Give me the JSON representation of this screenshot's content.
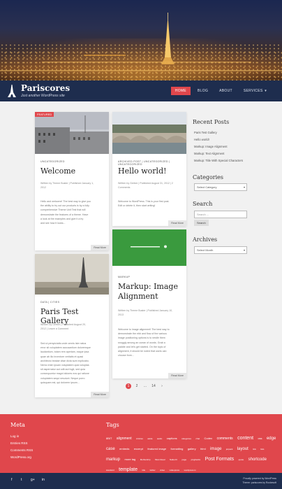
{
  "site": {
    "title": "Pariscores",
    "tagline": "Just another WordPress site"
  },
  "nav": {
    "items": [
      {
        "label": "HOME",
        "active": true
      },
      {
        "label": "BLOG",
        "active": false
      },
      {
        "label": "ABOUT",
        "active": false
      },
      {
        "label": "SERVICES",
        "active": false,
        "has_dropdown": true
      }
    ]
  },
  "posts": [
    {
      "badge": "FEATURED",
      "category": "UNCATEGORIZED",
      "title": "Welcome",
      "meta_line1": "Written by Theme Buster | Published January 1,",
      "meta_line2": "2012",
      "excerpt": [
        "Hello and welcome! The best way to give you",
        "the ability to try out our products is by a fully",
        "comprehensive Theme Unit Test that will",
        "demonstrate the features of a theme. Have",
        "a look at the examples and give it a try",
        "and see how it looks..."
      ],
      "read_more": "Read More"
    },
    {
      "category": "ARCHIVED POST | UNCATEGORIZED | UNCATEGORIZED",
      "title": "Hello world!",
      "meta_line1": "Written by Gerber | Published August 31, 2012 | 2",
      "meta_line2": "Comments",
      "excerpt": [
        "Welcome to WordPress. This is your first post.",
        "Edit or delete it, then start writing!"
      ],
      "read_more": "Read More"
    },
    {
      "category": "DATA | CITIES",
      "title": "Paris Test Gallery",
      "meta_line1": "Written by Gerber | Published August 20,",
      "meta_line2": "2012 | Leave a Comment",
      "excerpt": [
        "Sed ut perspiciatis unde omnis iste natus",
        "error sit voluptatem accusantium doloremque",
        "laudantium, totam rem aperiam, eaque ipsa",
        "quae ab illo inventore veritatis et quasi",
        "architecto beatae vitae dicta sunt explicabo.",
        "Nemo enim ipsam voluptatem quia voluptas",
        "sit aspernatur aut odit aut fugit, sed quia",
        "consequuntur magni dolores eos qui ratione",
        "voluptatem sequi nesciunt. Neque porro",
        "quisquam est, qui dolorem ipsum..."
      ],
      "read_more": "Read More"
    },
    {
      "category": "MARKUP",
      "title_line1": "Markup: Image",
      "title_line2": "Alignment",
      "meta_line1": "Written by Theme Buster | Published January 10,",
      "meta_line2": "2013",
      "excerpt": [
        "Welcome to image alignment! The best way to",
        "demonstrate the ebb and flow of the various",
        "image positioning options is to nestle them",
        "snuggly among an ocean of words. Grab a",
        "paddle and let's get started. On the topic of",
        "alignment, it should be noted that users can",
        "choose from..."
      ],
      "read_more": "Read More"
    }
  ],
  "pagination": {
    "pages": [
      "1",
      "2",
      "...",
      "14"
    ],
    "next": "›"
  },
  "sidebar": {
    "recent_title": "Recent Posts",
    "recent": [
      "Paris Test Gallery",
      "Hello world!",
      "Markup: Image Alignment",
      "Markup: Text Alignment",
      "Markup: Title With Special Characters"
    ],
    "categories_title": "Categories",
    "categories_select": "Select Category",
    "search_title": "Search",
    "search_placeholder": "Search ...",
    "search_button": "Search",
    "archives_title": "Archives",
    "archives_select": "Select Month"
  },
  "footer": {
    "meta_title": "Meta",
    "meta_links": [
      "Log in",
      "Entries RSS",
      "Comments RSS",
      "WordPress.org"
    ],
    "tags_title": "Tags",
    "tags": [
      {
        "t": "8BIT",
        "s": 4
      },
      {
        "t": "alignment",
        "s": 5
      },
      {
        "t": "Articles",
        "s": 3
      },
      {
        "t": "aside",
        "s": 3
      },
      {
        "t": "audio",
        "s": 3
      },
      {
        "t": "captions",
        "s": 4
      },
      {
        "t": "categories",
        "s": 3
      },
      {
        "t": "chat",
        "s": 3
      },
      {
        "t": "Codex",
        "s": 4
      },
      {
        "t": "comments",
        "s": 5
      },
      {
        "t": "content",
        "s": 7
      },
      {
        "t": "css",
        "s": 4
      },
      {
        "t": "edge case",
        "s": 6
      },
      {
        "t": "embeds",
        "s": 4
      },
      {
        "t": "excerpt",
        "s": 4
      },
      {
        "t": "featured image",
        "s": 4
      },
      {
        "t": "formatting",
        "s": 4
      },
      {
        "t": "gallery",
        "s": 4
      },
      {
        "t": "html",
        "s": 4
      },
      {
        "t": "image",
        "s": 6
      },
      {
        "t": "jetpack",
        "s": 3
      },
      {
        "t": "layout",
        "s": 6
      },
      {
        "t": "link",
        "s": 3
      },
      {
        "t": "lists",
        "s": 3
      },
      {
        "t": "markup",
        "s": 6
      },
      {
        "t": "more tag",
        "s": 4
      },
      {
        "t": "Mothership",
        "s": 3
      },
      {
        "t": "Must Read",
        "s": 3
      },
      {
        "t": "Nailed It",
        "s": 3
      },
      {
        "t": "page",
        "s": 3
      },
      {
        "t": "pingbacks",
        "s": 3
      },
      {
        "t": "Post Formats",
        "s": 7
      },
      {
        "t": "quote",
        "s": 3
      },
      {
        "t": "shortcode",
        "s": 6
      },
      {
        "t": "standard",
        "s": 3
      },
      {
        "t": "template",
        "s": 7
      },
      {
        "t": "title",
        "s": 3
      },
      {
        "t": "twitter",
        "s": 3
      },
      {
        "t": "video",
        "s": 3
      },
      {
        "t": "videopress",
        "s": 3
      },
      {
        "t": "wordpress.tv",
        "s": 3
      }
    ],
    "credit_line1": "Proudly powered by WordPress",
    "credit_line2": "Theme: pariscores by Rockesoft"
  },
  "social": [
    "f",
    "t",
    "g+",
    "in"
  ]
}
